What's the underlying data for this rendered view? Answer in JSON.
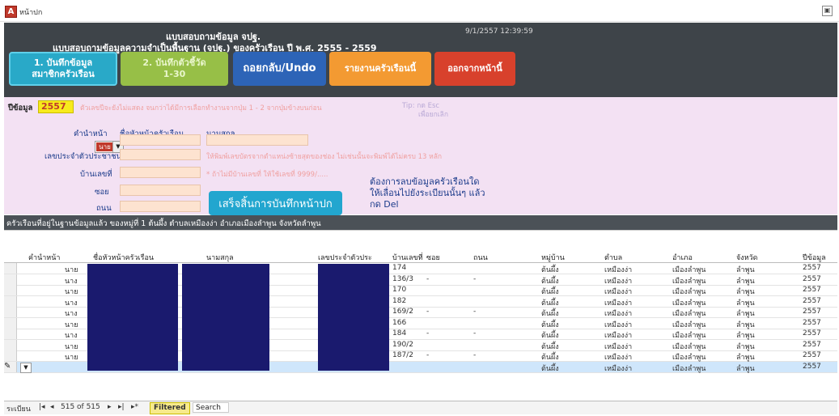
{
  "window": {
    "title": "หน้าปก",
    "app_icon": "A"
  },
  "header": {
    "line1": "แบบสอบถามข้อมูล จปฐ.",
    "line2": "แบบสอบถามข้อมูลความจำเป็นพื้นฐาน (จปฐ.) ของครัวเรือน ปี พ.ศ. 2555 - 2559",
    "datetime": "9/1/2557 12:39:59",
    "buttons": {
      "household_line1": "1. บันทึกข้อมูล",
      "household_line2": "สมาชิกครัวเรือน",
      "record_line1": "2. บันทึกตัวชี้วัด",
      "record_line2": "1-30",
      "undo": "ถอยกลับ/Undo",
      "report": "รายงานครัวเรือนนี้",
      "exit": "ออกจากหน้านี้"
    }
  },
  "form": {
    "year_label": "ปีข้อมูล",
    "year_value": "2557",
    "year_note": "ตัวเลขปีจะยังไม่แสดง จนกว่าได้มีการเลือกทำงานจากปุ่ม 1 - 2 จากปุ่มข้างบนก่อน",
    "tip": "Tip: กด Esc",
    "tip2": "เพื่อยกเลิก",
    "col_prefix": "คำนำหน้า",
    "col_head_name": "ชื่อหัวหน้าครัวเรือน",
    "col_surname": "นามสกุล",
    "prefix_value": "นาย",
    "id_label": "เลขประจำตัวประชาชน",
    "id_note": "ให้พิมพ์เลขบัตรจากตำแหน่งซ้ายสุดของช่อง ไม่เช่นนั้นจะพิมพ์ได้ไม่ครบ 13 หลัก",
    "house_label": "บ้านเลขที่",
    "house_note": "* ถ้าไม่มีบ้านเลขที่ ให้ใช้เลขที่ 9999/.....",
    "soi_label": "ซอย",
    "road_label": "ถนน",
    "finish_button": "เสร็จสิ้นการบันทึกหน้าปก",
    "delete_note_1": "ต้องการลบข้อมูลครัวเรือนใด",
    "delete_note_2": "ให้เลื่อนไปยังระเบียนนั้นๆ แล้ว",
    "delete_note_3": "กด Del"
  },
  "strip": {
    "text": "ครัวเรือนที่อยู่ในฐานข้อมูลแล้ว ของหมู่ที่ 1 ต้นผึ้ง ตำบลเหมืองง่า อำเภอเมืองลำพูน จังหวัดลำพูน"
  },
  "table": {
    "columns": [
      "คำนำหน้า",
      "ชื่อหัวหน้าครัวเรือน",
      "นามสกุล",
      "เลขประจำตัวประ",
      "บ้านเลขที่",
      "ซอย",
      "ถนน",
      "หมู่บ้าน",
      "ตำบล",
      "อำเภอ",
      "จังหวัด",
      "ปีข้อมูล"
    ],
    "rows": [
      [
        "นาย",
        "",
        "",
        "",
        "174",
        "",
        "",
        "ต้นผึ้ง",
        "เหมืองง่า",
        "เมืองลำพูน",
        "ลำพูน",
        "2557"
      ],
      [
        "นาง",
        "",
        "",
        "",
        "136/3",
        "-",
        "-",
        "ต้นผึ้ง",
        "เหมืองง่า",
        "เมืองลำพูน",
        "ลำพูน",
        "2557"
      ],
      [
        "นาย",
        "",
        "",
        "",
        "170",
        "",
        "",
        "ต้นผึ้ง",
        "เหมืองง่า",
        "เมืองลำพูน",
        "ลำพูน",
        "2557"
      ],
      [
        "นาง",
        "",
        "",
        "",
        "182",
        "",
        "",
        "ต้นผึ้ง",
        "เหมืองง่า",
        "เมืองลำพูน",
        "ลำพูน",
        "2557"
      ],
      [
        "นาง",
        "",
        "",
        "",
        "169/2",
        "-",
        "-",
        "ต้นผึ้ง",
        "เหมืองง่า",
        "เมืองลำพูน",
        "ลำพูน",
        "2557"
      ],
      [
        "นาย",
        "",
        "",
        "",
        "166",
        "",
        "",
        "ต้นผึ้ง",
        "เหมืองง่า",
        "เมืองลำพูน",
        "ลำพูน",
        "2557"
      ],
      [
        "นาง",
        "",
        "",
        "",
        "184",
        "-",
        "-",
        "ต้นผึ้ง",
        "เหมืองง่า",
        "เมืองลำพูน",
        "ลำพูน",
        "2557"
      ],
      [
        "นาย",
        "",
        "",
        "",
        "190/2",
        "",
        "",
        "ต้นผึ้ง",
        "เหมืองง่า",
        "เมืองลำพูน",
        "ลำพูน",
        "2557"
      ],
      [
        "นาย",
        "",
        "",
        "",
        "187/2",
        "-",
        "-",
        "ต้นผึ้ง",
        "เหมืองง่า",
        "เมืองลำพูน",
        "ลำพูน",
        "2557"
      ]
    ],
    "new_row": [
      "",
      "",
      "",
      "",
      "",
      "",
      "",
      "ต้นผึ้ง",
      "เหมืองง่า",
      "เมืองลำพูน",
      "ลำพูน",
      "2557"
    ]
  },
  "nav": {
    "record_label": "ระเบียน",
    "position": "515 of 515",
    "filtered": "Filtered",
    "search": "Search"
  },
  "colors": {
    "header_bg": "#3e4449",
    "form_bg": "#f3e1f3",
    "redaction": "#1a1a6e"
  }
}
